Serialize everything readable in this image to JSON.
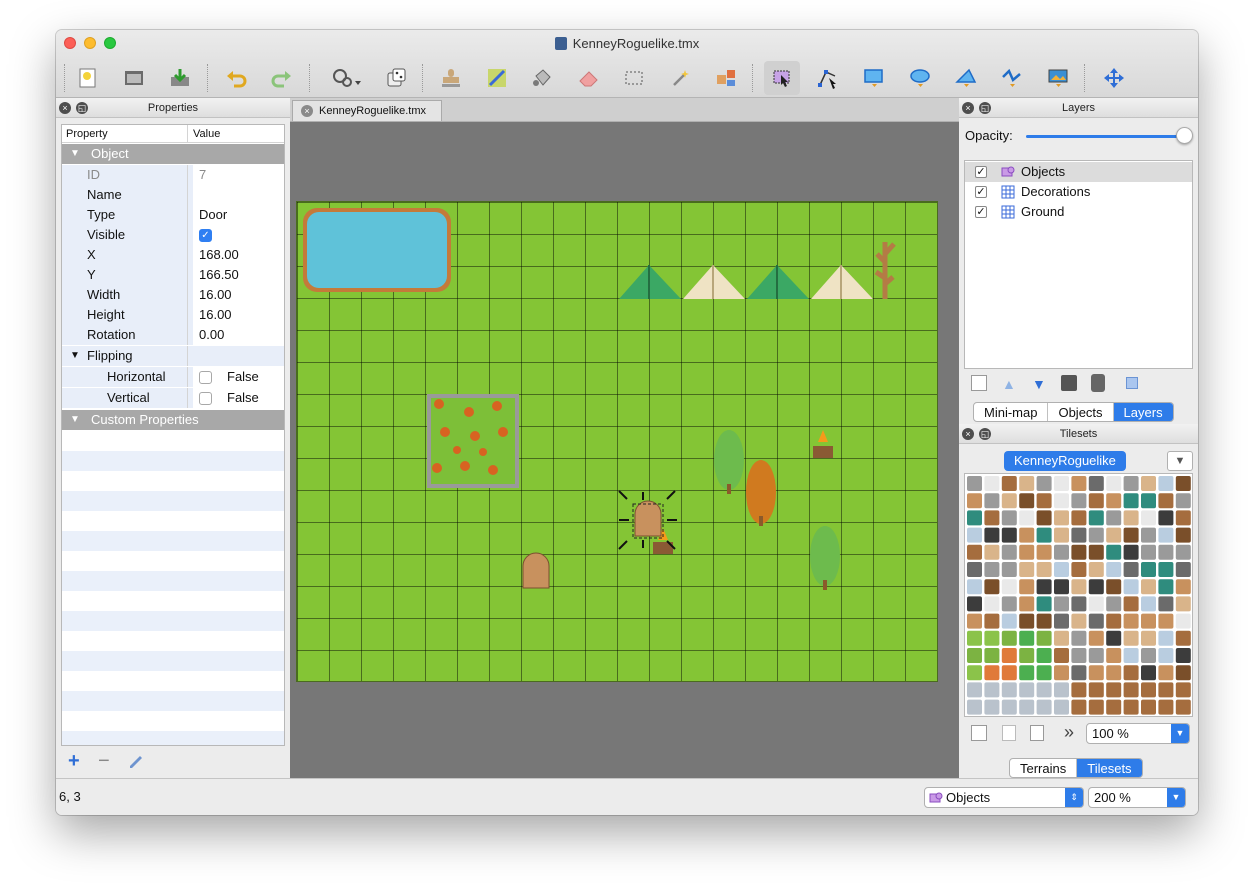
{
  "window": {
    "title": "KenneyRoguelike.tmx"
  },
  "toolbar": {
    "buttons": [
      "new-map-icon",
      "open-icon",
      "save-icon",
      "undo-icon",
      "redo-icon",
      "commands-icon",
      "random-mode-icon",
      "stamp-brush-icon",
      "terrain-brush-icon",
      "bucket-fill-icon",
      "eraser-icon",
      "rect-select-icon",
      "magic-wand-icon",
      "select-same-tile-icon",
      "select-objects-icon",
      "edit-polygons-icon",
      "insert-rectangle-icon",
      "insert-ellipse-icon",
      "insert-polygon-icon",
      "insert-polyline-icon",
      "insert-tile-icon",
      "move-icon"
    ],
    "active": "select-objects-icon"
  },
  "properties": {
    "panel_title": "Properties",
    "col_property": "Property",
    "col_value": "Value",
    "group_object": "Object",
    "rows": [
      {
        "name": "ID",
        "value": "7",
        "dim": true
      },
      {
        "name": "Name",
        "value": ""
      },
      {
        "name": "Type",
        "value": "Door"
      },
      {
        "name": "Visible",
        "value": "",
        "checkbox": true,
        "checked": true
      },
      {
        "name": "X",
        "value": "168.00"
      },
      {
        "name": "Y",
        "value": "166.50"
      },
      {
        "name": "Width",
        "value": "16.00"
      },
      {
        "name": "Height",
        "value": "16.00"
      },
      {
        "name": "Rotation",
        "value": "0.00"
      }
    ],
    "flipping": "Flipping",
    "flip_rows": [
      {
        "name": "Horizontal",
        "value": "False"
      },
      {
        "name": "Vertical",
        "value": "False"
      }
    ],
    "group_custom": "Custom Properties",
    "add_label": "+",
    "remove_label": "−"
  },
  "tab": {
    "label": "KenneyRoguelike.tmx"
  },
  "layers": {
    "panel_title": "Layers",
    "opacity_label": "Opacity:",
    "opacity": 1.0,
    "items": [
      {
        "name": "Objects",
        "type": "object",
        "visible": true,
        "selected": true
      },
      {
        "name": "Decorations",
        "type": "tile",
        "visible": true
      },
      {
        "name": "Ground",
        "type": "tile",
        "visible": true
      }
    ],
    "tabs": [
      "Mini-map",
      "Objects",
      "Layers"
    ],
    "active_tab": "Layers"
  },
  "tilesets": {
    "panel_title": "Tilesets",
    "active": "KenneyRoguelike",
    "zoom": "100 %",
    "more": "»",
    "tabs": [
      "Terrains",
      "Tilesets"
    ],
    "active_tab": "Tilesets"
  },
  "status": {
    "coords": "6, 3",
    "layer_combo": "Objects",
    "zoom": "200 %"
  },
  "colors": {
    "accent": "#2e7ce9",
    "grass": "#84c535",
    "water": "#55c4d8"
  }
}
